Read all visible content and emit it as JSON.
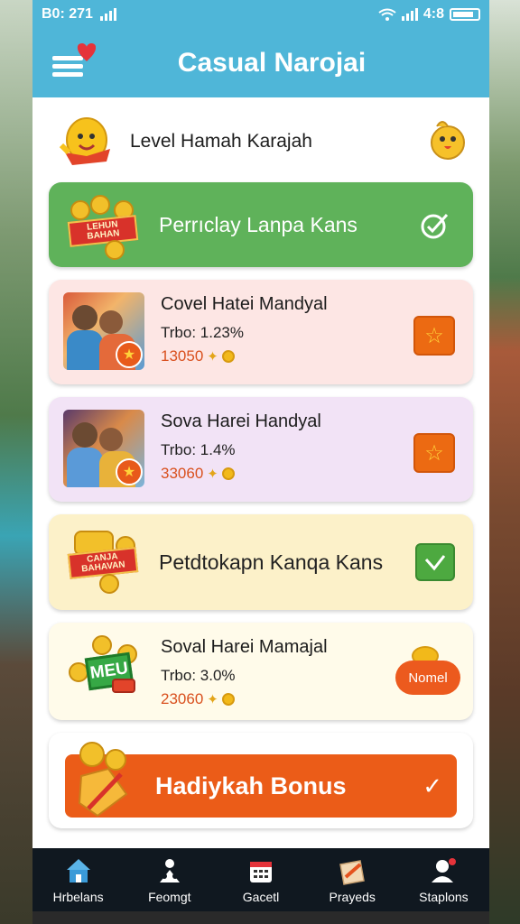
{
  "status_bar": {
    "time": "B0: 271",
    "battery": "4:8"
  },
  "header": {
    "title": "Casual Narojai"
  },
  "level": {
    "label": "Level Hamah Karajah"
  },
  "cards": [
    {
      "type": "banner",
      "badge": "LEHUN BAHAN",
      "title": "Perrıclay Lanpa Kans"
    },
    {
      "type": "item",
      "name": "Covel Hatei Mandyal",
      "rate": "Trbo: 1.23%",
      "coins": "13050"
    },
    {
      "type": "item",
      "name": "Sova Harei Handyal",
      "rate": "Trbo: 1.4%",
      "coins": "33060"
    },
    {
      "type": "banner",
      "badge": "CANJA BAHAVAN",
      "title": "Petdtokapn Kanqa Kans"
    },
    {
      "type": "item",
      "name": "Soval Harei Mamajal",
      "rate": "Trbo: 3.0%",
      "coins": "23060",
      "badge": "MEU",
      "button": "Nomel"
    }
  ],
  "bonus": {
    "label": "Hadiykah Bonus"
  },
  "tabs": [
    {
      "label": "Hrbelans",
      "icon": "home-icon"
    },
    {
      "label": "Feomgt",
      "icon": "games-icon"
    },
    {
      "label": "Gacetl",
      "icon": "calendar-icon"
    },
    {
      "label": "Prayeds",
      "icon": "gift-icon"
    },
    {
      "label": "Staplons",
      "icon": "profile-icon"
    }
  ],
  "colors": {
    "header": "#4fb6d8",
    "green_card": "#5fb25a",
    "accent_orange": "#eb5c18",
    "tabbar": "#101820"
  }
}
